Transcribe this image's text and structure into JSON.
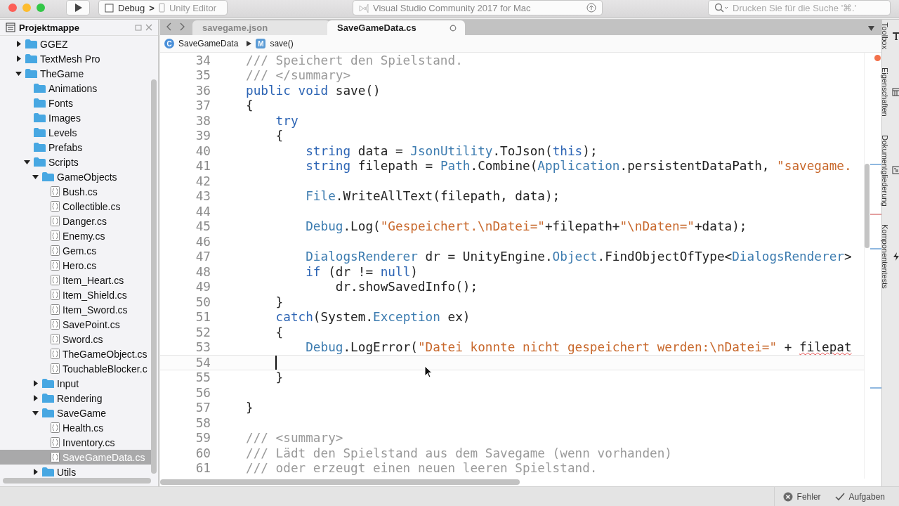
{
  "toolbar": {
    "run_config": "Debug",
    "separator": ">",
    "target": "Unity Editor",
    "title": "Visual Studio Community 2017 for Mac",
    "search": {
      "placeholder": "Drucken Sie für die Suche '⌘.'"
    }
  },
  "solution": {
    "title": "Projektmappe",
    "tree": [
      {
        "label": "GGEZ",
        "kind": "folder",
        "expanded": false,
        "selected": false
      },
      {
        "label": "TextMesh Pro",
        "kind": "folder",
        "expanded": false,
        "selected": false
      },
      {
        "label": "TheGame",
        "kind": "folder",
        "expanded": true,
        "selected": false,
        "children": [
          {
            "label": "Animations",
            "kind": "folder",
            "selected": false
          },
          {
            "label": "Fonts",
            "kind": "folder",
            "selected": false
          },
          {
            "label": "Images",
            "kind": "folder",
            "selected": false
          },
          {
            "label": "Levels",
            "kind": "folder",
            "selected": false
          },
          {
            "label": "Prefabs",
            "kind": "folder",
            "selected": false
          },
          {
            "label": "Scripts",
            "kind": "folder",
            "expanded": true,
            "selected": false,
            "children": [
              {
                "label": "GameObjects",
                "kind": "folder",
                "expanded": true,
                "selected": false,
                "children": [
                  {
                    "label": "Bush.cs",
                    "kind": "file",
                    "selected": false
                  },
                  {
                    "label": "Collectible.cs",
                    "kind": "file",
                    "selected": false
                  },
                  {
                    "label": "Danger.cs",
                    "kind": "file",
                    "selected": false
                  },
                  {
                    "label": "Enemy.cs",
                    "kind": "file",
                    "selected": false
                  },
                  {
                    "label": "Gem.cs",
                    "kind": "file",
                    "selected": false
                  },
                  {
                    "label": "Hero.cs",
                    "kind": "file",
                    "selected": false
                  },
                  {
                    "label": "Item_Heart.cs",
                    "kind": "file",
                    "selected": false
                  },
                  {
                    "label": "Item_Shield.cs",
                    "kind": "file",
                    "selected": false
                  },
                  {
                    "label": "Item_Sword.cs",
                    "kind": "file",
                    "selected": false
                  },
                  {
                    "label": "SavePoint.cs",
                    "kind": "file",
                    "selected": false
                  },
                  {
                    "label": "Sword.cs",
                    "kind": "file",
                    "selected": false
                  },
                  {
                    "label": "TheGameObject.cs",
                    "kind": "file",
                    "selected": false
                  },
                  {
                    "label": "TouchableBlocker.c",
                    "kind": "file",
                    "selected": false
                  }
                ]
              },
              {
                "label": "Input",
                "kind": "folder",
                "expanded": false,
                "selected": false
              },
              {
                "label": "Rendering",
                "kind": "folder",
                "expanded": false,
                "selected": false
              },
              {
                "label": "SaveGame",
                "kind": "folder",
                "expanded": true,
                "selected": false,
                "children": [
                  {
                    "label": "Health.cs",
                    "kind": "file",
                    "selected": false
                  },
                  {
                    "label": "Inventory.cs",
                    "kind": "file",
                    "selected": false
                  },
                  {
                    "label": "SaveGameData.cs",
                    "kind": "file",
                    "selected": true
                  }
                ]
              },
              {
                "label": "Utils",
                "kind": "folder",
                "expanded": false,
                "selected": false
              }
            ]
          }
        ]
      }
    ]
  },
  "editor": {
    "tabs": [
      {
        "label": "savegame.json",
        "selected": false
      },
      {
        "label": "SaveGameData.cs",
        "selected": true
      }
    ],
    "breadcrumb": [
      {
        "icon_letter": "C",
        "label": "SaveGameData"
      },
      {
        "icon_letter": "M",
        "label": "save()"
      }
    ],
    "lines": [
      {
        "number": "34",
        "current": false,
        "tokens": [
          {
            "kind": "comment",
            "text": "/// Speichert den Spielstand."
          }
        ]
      },
      {
        "number": "35",
        "current": false,
        "tokens": [
          {
            "kind": "comment",
            "text": "/// </summary>"
          }
        ]
      },
      {
        "number": "36",
        "current": false,
        "tokens": [
          {
            "kind": "keyword",
            "text": "public void"
          },
          {
            "kind": "plain",
            "text": " save()"
          }
        ]
      },
      {
        "number": "37",
        "current": false,
        "tokens": [
          {
            "kind": "plain",
            "text": "{"
          }
        ]
      },
      {
        "number": "38",
        "current": false,
        "tokens": [
          {
            "kind": "keyword",
            "text": "    try"
          }
        ]
      },
      {
        "number": "39",
        "current": false,
        "tokens": [
          {
            "kind": "plain",
            "text": "    {"
          }
        ]
      },
      {
        "number": "40",
        "current": false,
        "tokens": [
          {
            "kind": "keyword",
            "text": "        string"
          },
          {
            "kind": "plain",
            "text": " data = "
          },
          {
            "kind": "type",
            "text": "JsonUtility"
          },
          {
            "kind": "plain",
            "text": ".ToJson("
          },
          {
            "kind": "keyword",
            "text": "this"
          },
          {
            "kind": "plain",
            "text": ");"
          }
        ]
      },
      {
        "number": "41",
        "current": false,
        "tokens": [
          {
            "kind": "keyword",
            "text": "        string"
          },
          {
            "kind": "plain",
            "text": " filepath = "
          },
          {
            "kind": "type",
            "text": "Path"
          },
          {
            "kind": "plain",
            "text": ".Combine("
          },
          {
            "kind": "type",
            "text": "Application"
          },
          {
            "kind": "plain",
            "text": ".persistentDataPath, "
          },
          {
            "kind": "string",
            "text": "\"savegame."
          }
        ]
      },
      {
        "number": "42",
        "current": false
      },
      {
        "number": "43",
        "current": false,
        "tokens": [
          {
            "kind": "type",
            "text": "        File"
          },
          {
            "kind": "plain",
            "text": ".WriteAllText(filepath, data);"
          }
        ]
      },
      {
        "number": "44",
        "current": false
      },
      {
        "number": "45",
        "current": false,
        "tokens": [
          {
            "kind": "type",
            "text": "        Debug"
          },
          {
            "kind": "plain",
            "text": ".Log("
          },
          {
            "kind": "string",
            "text": "\"Gespeichert.\\nDatei=\""
          },
          {
            "kind": "plain",
            "text": "+filepath+"
          },
          {
            "kind": "string",
            "text": "\"\\nDaten=\""
          },
          {
            "kind": "plain",
            "text": "+data);"
          }
        ]
      },
      {
        "number": "46",
        "current": false
      },
      {
        "number": "47",
        "current": false,
        "tokens": [
          {
            "kind": "type",
            "text": "        DialogsRenderer"
          },
          {
            "kind": "plain",
            "text": " dr = UnityEngine."
          },
          {
            "kind": "type",
            "text": "Object"
          },
          {
            "kind": "plain",
            "text": ".FindObjectOfType<"
          },
          {
            "kind": "type",
            "text": "DialogsRenderer"
          },
          {
            "kind": "plain",
            "text": ">"
          }
        ]
      },
      {
        "number": "48",
        "current": false,
        "tokens": [
          {
            "kind": "keyword",
            "text": "        if"
          },
          {
            "kind": "plain",
            "text": " (dr != "
          },
          {
            "kind": "keyword",
            "text": "null"
          },
          {
            "kind": "plain",
            "text": ")"
          }
        ]
      },
      {
        "number": "49",
        "current": false,
        "tokens": [
          {
            "kind": "plain",
            "text": "            dr.showSavedInfo();"
          }
        ]
      },
      {
        "number": "50",
        "current": false,
        "tokens": [
          {
            "kind": "plain",
            "text": "    }"
          }
        ]
      },
      {
        "number": "51",
        "current": false,
        "tokens": [
          {
            "kind": "keyword",
            "text": "    catch"
          },
          {
            "kind": "plain",
            "text": "(System."
          },
          {
            "kind": "type",
            "text": "Exception"
          },
          {
            "kind": "plain",
            "text": " ex)"
          }
        ]
      },
      {
        "number": "52",
        "current": false,
        "tokens": [
          {
            "kind": "plain",
            "text": "    {"
          }
        ]
      },
      {
        "number": "53",
        "current": false,
        "tokens": [
          {
            "kind": "type",
            "text": "        Debug"
          },
          {
            "kind": "plain",
            "text": ".LogError("
          },
          {
            "kind": "string",
            "text": "\"Datei konnte nicht gespeichert werden:\\nDatei=\""
          },
          {
            "kind": "plain",
            "text": " + "
          },
          {
            "kind": "error",
            "text": "filepat"
          }
        ]
      },
      {
        "number": "54",
        "current": true
      },
      {
        "number": "55",
        "current": false,
        "tokens": [
          {
            "kind": "plain",
            "text": "    }"
          }
        ]
      },
      {
        "number": "56",
        "current": false
      },
      {
        "number": "57",
        "current": false,
        "tokens": [
          {
            "kind": "plain",
            "text": "}"
          }
        ]
      },
      {
        "number": "58",
        "current": false
      },
      {
        "number": "59",
        "current": false,
        "tokens": [
          {
            "kind": "comment",
            "text": "/// <summary>"
          }
        ]
      },
      {
        "number": "60",
        "current": false,
        "tokens": [
          {
            "kind": "comment",
            "text": "/// Lädt den Spielstand aus dem Savegame (wenn vorhanden)"
          }
        ]
      },
      {
        "number": "61",
        "current": false,
        "tokens": [
          {
            "kind": "comment",
            "text": "/// oder erzeugt einen neuen leeren Spielstand."
          }
        ]
      }
    ]
  },
  "side_pads": [
    {
      "label": "Toolbox",
      "kind": "toolbox"
    },
    {
      "label": "Eigenschaften",
      "kind": "properties"
    },
    {
      "label": "Dokumentgliederung",
      "kind": "outline"
    },
    {
      "label": "Komponententests",
      "kind": "tests"
    }
  ],
  "status_bar": [
    {
      "label": "Fehler",
      "kind": "errors"
    },
    {
      "label": "Aufgaben",
      "kind": "tasks"
    }
  ]
}
